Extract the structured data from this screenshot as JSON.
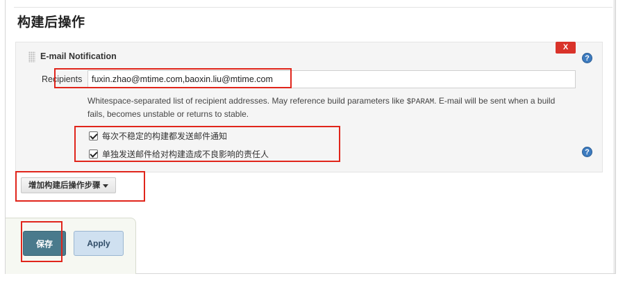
{
  "section_title": "构建后操作",
  "notification": {
    "title": "E-mail Notification",
    "delete_label": "X",
    "help_icon": "?",
    "recipients_label": "Recipients",
    "recipients_value": "fuxin.zhao@mtime.com,baoxin.liu@mtime.com",
    "description_before": "Whitespace-separated list of recipient addresses. May reference build parameters like ",
    "description_param": "$PARAM",
    "description_after": ". E-mail will be sent when a build fails, becomes unstable or returns to stable.",
    "checkbox_unstable": {
      "label": "每次不稳定的构建都发送邮件通知",
      "checked": true
    },
    "checkbox_individual": {
      "label": "单独发送邮件给对构建造成不良影响的责任人",
      "checked": true
    }
  },
  "add_step_label": "增加构建后操作步骤",
  "buttons": {
    "save_label": "保存",
    "apply_label": "Apply"
  },
  "colors": {
    "highlight": "#e0251b",
    "save": "#4a7a8c",
    "apply": "#cfe0f0",
    "delete": "#d9332a",
    "help": "#3d7bbf"
  }
}
